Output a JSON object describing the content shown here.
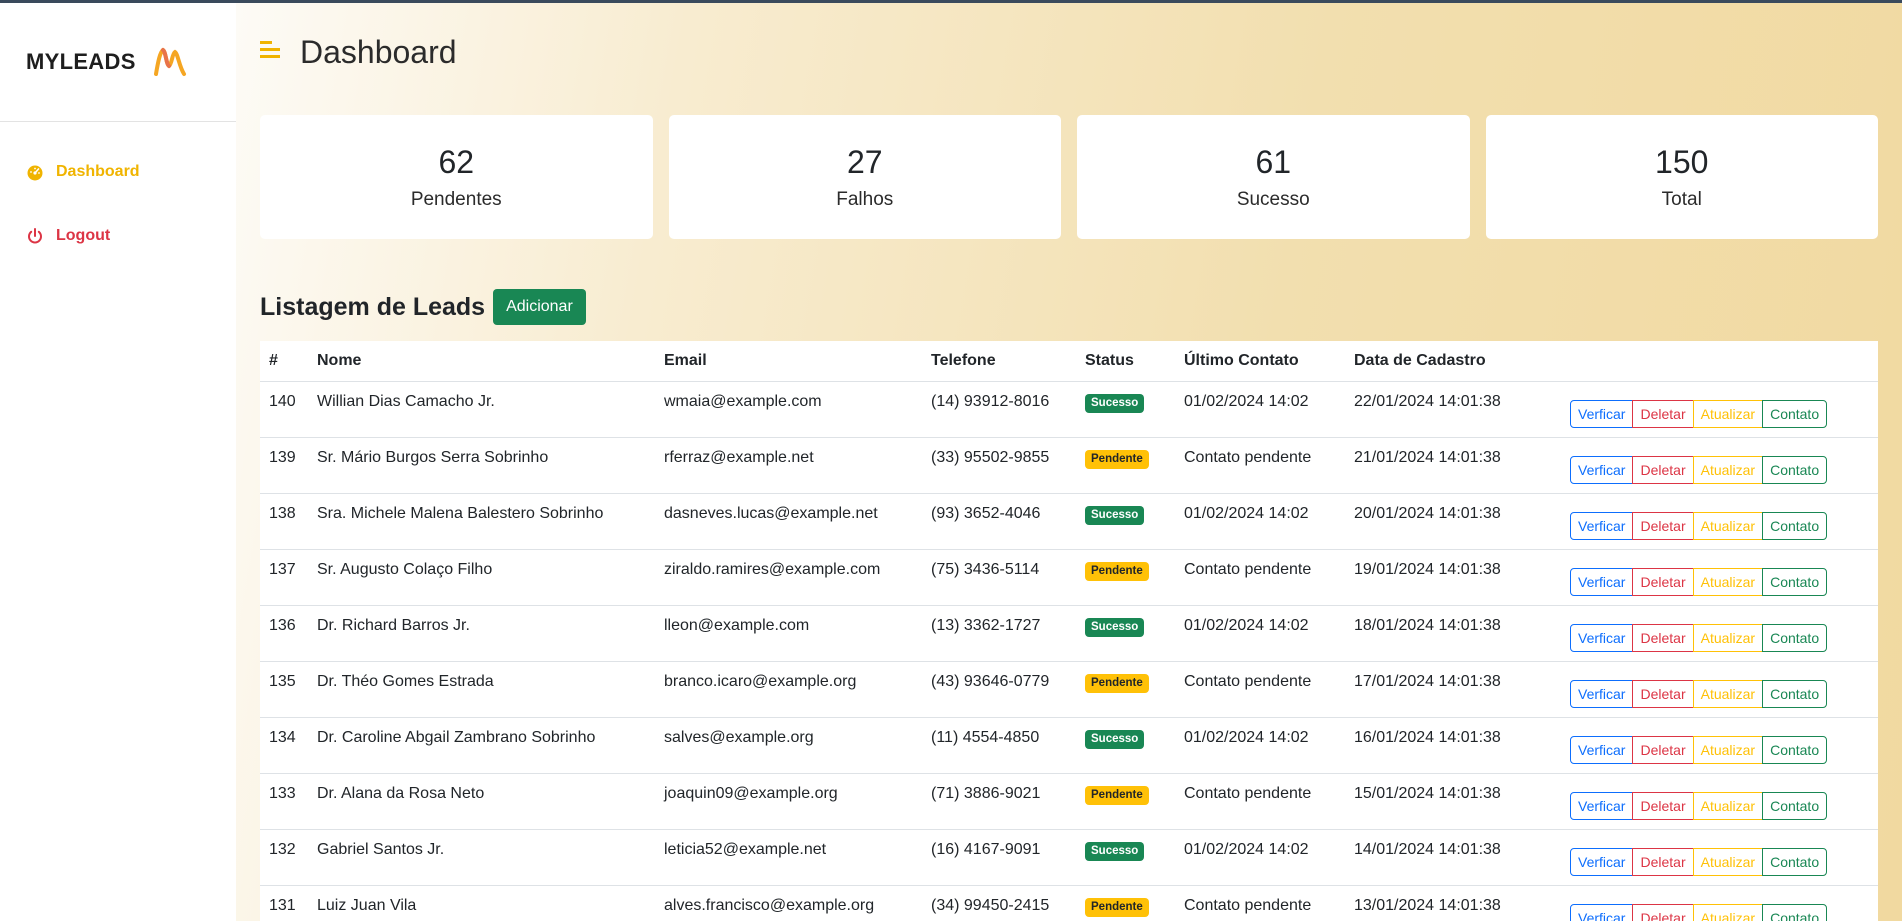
{
  "brand": {
    "name": "MYLEADS"
  },
  "sidebar": {
    "items": [
      {
        "label": "Dashboard",
        "icon": "gauge-icon",
        "color": "#f0b400"
      },
      {
        "label": "Logout",
        "icon": "power-icon",
        "color": "#dc3545"
      }
    ]
  },
  "header": {
    "title": "Dashboard"
  },
  "stats": [
    {
      "value": "62",
      "label": "Pendentes"
    },
    {
      "value": "27",
      "label": "Falhos"
    },
    {
      "value": "61",
      "label": "Sucesso"
    },
    {
      "value": "150",
      "label": "Total"
    }
  ],
  "list": {
    "title": "Listagem de Leads",
    "add_label": "Adicionar",
    "columns": [
      "#",
      "Nome",
      "Email",
      "Telefone",
      "Status",
      "Último Contato",
      "Data de Cadastro",
      ""
    ],
    "actions": [
      "Verficar",
      "Deletar",
      "Atualizar",
      "Contato"
    ],
    "rows": [
      {
        "id": "140",
        "name": "Willian Dias Camacho Jr.",
        "email": "wmaia@example.com",
        "phone": "(14) 93912-8016",
        "status": "Sucesso",
        "last_contact": "01/02/2024 14:02",
        "created": "22/01/2024 14:01:38"
      },
      {
        "id": "139",
        "name": "Sr. Mário Burgos Serra Sobrinho",
        "email": "rferraz@example.net",
        "phone": "(33) 95502-9855",
        "status": "Pendente",
        "last_contact": "Contato pendente",
        "created": "21/01/2024 14:01:38"
      },
      {
        "id": "138",
        "name": "Sra. Michele Malena Balestero Sobrinho",
        "email": "dasneves.lucas@example.net",
        "phone": "(93) 3652-4046",
        "status": "Sucesso",
        "last_contact": "01/02/2024 14:02",
        "created": "20/01/2024 14:01:38"
      },
      {
        "id": "137",
        "name": "Sr. Augusto Colaço Filho",
        "email": "ziraldo.ramires@example.com",
        "phone": "(75) 3436-5114",
        "status": "Pendente",
        "last_contact": "Contato pendente",
        "created": "19/01/2024 14:01:38"
      },
      {
        "id": "136",
        "name": "Dr. Richard Barros Jr.",
        "email": "lleon@example.com",
        "phone": "(13) 3362-1727",
        "status": "Sucesso",
        "last_contact": "01/02/2024 14:02",
        "created": "18/01/2024 14:01:38"
      },
      {
        "id": "135",
        "name": "Dr. Théo Gomes Estrada",
        "email": "branco.icaro@example.org",
        "phone": "(43) 93646-0779",
        "status": "Pendente",
        "last_contact": "Contato pendente",
        "created": "17/01/2024 14:01:38"
      },
      {
        "id": "134",
        "name": "Dr. Caroline Abgail Zambrano Sobrinho",
        "email": "salves@example.org",
        "phone": "(11) 4554-4850",
        "status": "Sucesso",
        "last_contact": "01/02/2024 14:02",
        "created": "16/01/2024 14:01:38"
      },
      {
        "id": "133",
        "name": "Dr. Alana da Rosa Neto",
        "email": "joaquin09@example.org",
        "phone": "(71) 3886-9021",
        "status": "Pendente",
        "last_contact": "Contato pendente",
        "created": "15/01/2024 14:01:38"
      },
      {
        "id": "132",
        "name": "Gabriel Santos Jr.",
        "email": "leticia52@example.net",
        "phone": "(16) 4167-9091",
        "status": "Sucesso",
        "last_contact": "01/02/2024 14:02",
        "created": "14/01/2024 14:01:38"
      },
      {
        "id": "131",
        "name": "Luiz Juan Vila",
        "email": "alves.francisco@example.org",
        "phone": "(34) 99450-2415",
        "status": "Pendente",
        "last_contact": "Contato pendente",
        "created": "13/01/2024 14:01:38"
      }
    ]
  },
  "colors": {
    "accent": "#f0b400",
    "success": "#198754",
    "pending": "#ffc107",
    "danger": "#dc3545",
    "primary": "#0d6efd"
  }
}
